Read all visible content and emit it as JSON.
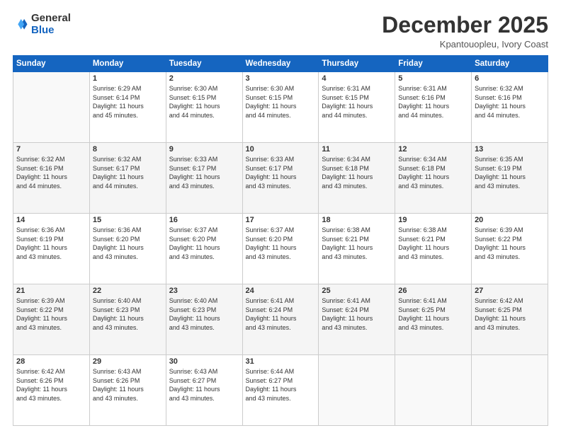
{
  "header": {
    "logo_general": "General",
    "logo_blue": "Blue",
    "month": "December 2025",
    "location": "Kpantouopleu, Ivory Coast"
  },
  "weekdays": [
    "Sunday",
    "Monday",
    "Tuesday",
    "Wednesday",
    "Thursday",
    "Friday",
    "Saturday"
  ],
  "weeks": [
    [
      {
        "day": "",
        "text": ""
      },
      {
        "day": "1",
        "text": "Sunrise: 6:29 AM\nSunset: 6:14 PM\nDaylight: 11 hours\nand 45 minutes."
      },
      {
        "day": "2",
        "text": "Sunrise: 6:30 AM\nSunset: 6:15 PM\nDaylight: 11 hours\nand 44 minutes."
      },
      {
        "day": "3",
        "text": "Sunrise: 6:30 AM\nSunset: 6:15 PM\nDaylight: 11 hours\nand 44 minutes."
      },
      {
        "day": "4",
        "text": "Sunrise: 6:31 AM\nSunset: 6:15 PM\nDaylight: 11 hours\nand 44 minutes."
      },
      {
        "day": "5",
        "text": "Sunrise: 6:31 AM\nSunset: 6:16 PM\nDaylight: 11 hours\nand 44 minutes."
      },
      {
        "day": "6",
        "text": "Sunrise: 6:32 AM\nSunset: 6:16 PM\nDaylight: 11 hours\nand 44 minutes."
      }
    ],
    [
      {
        "day": "7",
        "text": "Sunrise: 6:32 AM\nSunset: 6:16 PM\nDaylight: 11 hours\nand 44 minutes."
      },
      {
        "day": "8",
        "text": "Sunrise: 6:32 AM\nSunset: 6:17 PM\nDaylight: 11 hours\nand 44 minutes."
      },
      {
        "day": "9",
        "text": "Sunrise: 6:33 AM\nSunset: 6:17 PM\nDaylight: 11 hours\nand 43 minutes."
      },
      {
        "day": "10",
        "text": "Sunrise: 6:33 AM\nSunset: 6:17 PM\nDaylight: 11 hours\nand 43 minutes."
      },
      {
        "day": "11",
        "text": "Sunrise: 6:34 AM\nSunset: 6:18 PM\nDaylight: 11 hours\nand 43 minutes."
      },
      {
        "day": "12",
        "text": "Sunrise: 6:34 AM\nSunset: 6:18 PM\nDaylight: 11 hours\nand 43 minutes."
      },
      {
        "day": "13",
        "text": "Sunrise: 6:35 AM\nSunset: 6:19 PM\nDaylight: 11 hours\nand 43 minutes."
      }
    ],
    [
      {
        "day": "14",
        "text": "Sunrise: 6:36 AM\nSunset: 6:19 PM\nDaylight: 11 hours\nand 43 minutes."
      },
      {
        "day": "15",
        "text": "Sunrise: 6:36 AM\nSunset: 6:20 PM\nDaylight: 11 hours\nand 43 minutes."
      },
      {
        "day": "16",
        "text": "Sunrise: 6:37 AM\nSunset: 6:20 PM\nDaylight: 11 hours\nand 43 minutes."
      },
      {
        "day": "17",
        "text": "Sunrise: 6:37 AM\nSunset: 6:20 PM\nDaylight: 11 hours\nand 43 minutes."
      },
      {
        "day": "18",
        "text": "Sunrise: 6:38 AM\nSunset: 6:21 PM\nDaylight: 11 hours\nand 43 minutes."
      },
      {
        "day": "19",
        "text": "Sunrise: 6:38 AM\nSunset: 6:21 PM\nDaylight: 11 hours\nand 43 minutes."
      },
      {
        "day": "20",
        "text": "Sunrise: 6:39 AM\nSunset: 6:22 PM\nDaylight: 11 hours\nand 43 minutes."
      }
    ],
    [
      {
        "day": "21",
        "text": "Sunrise: 6:39 AM\nSunset: 6:22 PM\nDaylight: 11 hours\nand 43 minutes."
      },
      {
        "day": "22",
        "text": "Sunrise: 6:40 AM\nSunset: 6:23 PM\nDaylight: 11 hours\nand 43 minutes."
      },
      {
        "day": "23",
        "text": "Sunrise: 6:40 AM\nSunset: 6:23 PM\nDaylight: 11 hours\nand 43 minutes."
      },
      {
        "day": "24",
        "text": "Sunrise: 6:41 AM\nSunset: 6:24 PM\nDaylight: 11 hours\nand 43 minutes."
      },
      {
        "day": "25",
        "text": "Sunrise: 6:41 AM\nSunset: 6:24 PM\nDaylight: 11 hours\nand 43 minutes."
      },
      {
        "day": "26",
        "text": "Sunrise: 6:41 AM\nSunset: 6:25 PM\nDaylight: 11 hours\nand 43 minutes."
      },
      {
        "day": "27",
        "text": "Sunrise: 6:42 AM\nSunset: 6:25 PM\nDaylight: 11 hours\nand 43 minutes."
      }
    ],
    [
      {
        "day": "28",
        "text": "Sunrise: 6:42 AM\nSunset: 6:26 PM\nDaylight: 11 hours\nand 43 minutes."
      },
      {
        "day": "29",
        "text": "Sunrise: 6:43 AM\nSunset: 6:26 PM\nDaylight: 11 hours\nand 43 minutes."
      },
      {
        "day": "30",
        "text": "Sunrise: 6:43 AM\nSunset: 6:27 PM\nDaylight: 11 hours\nand 43 minutes."
      },
      {
        "day": "31",
        "text": "Sunrise: 6:44 AM\nSunset: 6:27 PM\nDaylight: 11 hours\nand 43 minutes."
      },
      {
        "day": "",
        "text": ""
      },
      {
        "day": "",
        "text": ""
      },
      {
        "day": "",
        "text": ""
      }
    ]
  ]
}
